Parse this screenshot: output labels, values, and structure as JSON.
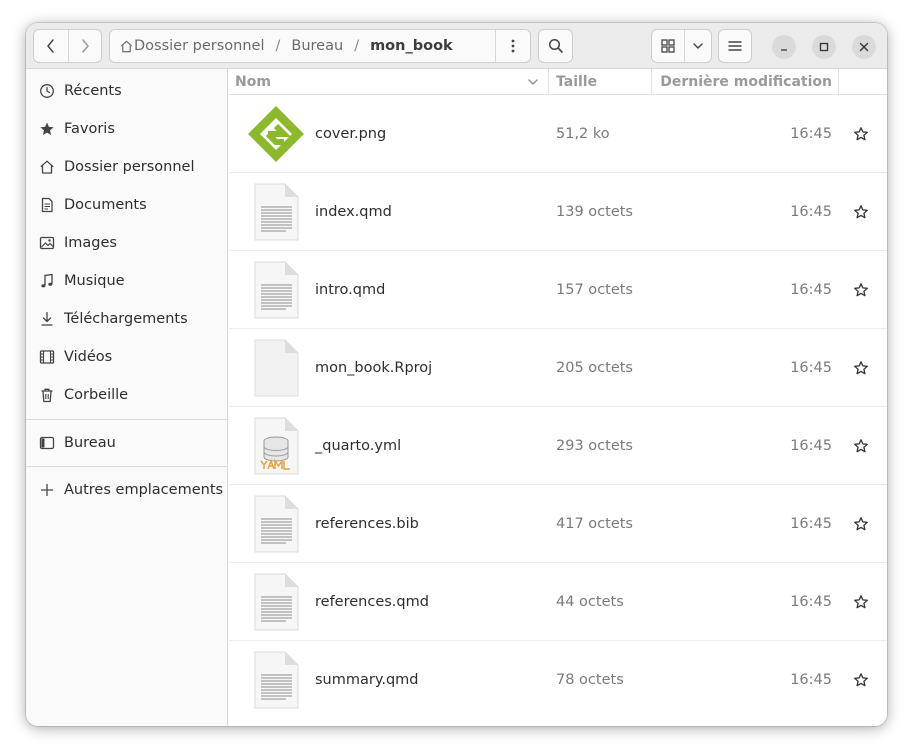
{
  "path": {
    "home": "Dossier personnel",
    "parent": "Bureau",
    "current": "mon_book",
    "separator": "/"
  },
  "sidebar": {
    "places": [
      {
        "label": "Récents",
        "icon": "clock-icon"
      },
      {
        "label": "Favoris",
        "icon": "star-icon"
      },
      {
        "label": "Dossier personnel",
        "icon": "home-icon"
      },
      {
        "label": "Documents",
        "icon": "document-icon"
      },
      {
        "label": "Images",
        "icon": "image-icon"
      },
      {
        "label": "Musique",
        "icon": "music-icon"
      },
      {
        "label": "Téléchargements",
        "icon": "download-icon"
      },
      {
        "label": "Vidéos",
        "icon": "video-icon"
      },
      {
        "label": "Corbeille",
        "icon": "trash-icon"
      }
    ],
    "bookmarks": [
      {
        "label": "Bureau",
        "icon": "desktop-icon"
      }
    ],
    "other": {
      "label": "Autres emplacements",
      "icon": "plus-icon"
    }
  },
  "columns": {
    "name": "Nom",
    "size": "Taille",
    "modified": "Dernière modification"
  },
  "files": [
    {
      "name": "cover.png",
      "size": "51,2 ko",
      "modified": "16:45",
      "type": "epub-image"
    },
    {
      "name": "index.qmd",
      "size": "139 octets",
      "modified": "16:45",
      "type": "text"
    },
    {
      "name": "intro.qmd",
      "size": "157 octets",
      "modified": "16:45",
      "type": "text"
    },
    {
      "name": "mon_book.Rproj",
      "size": "205 octets",
      "modified": "16:45",
      "type": "blank"
    },
    {
      "name": "_quarto.yml",
      "size": "293 octets",
      "modified": "16:45",
      "type": "yaml"
    },
    {
      "name": "references.bib",
      "size": "417 octets",
      "modified": "16:45",
      "type": "text"
    },
    {
      "name": "references.qmd",
      "size": "44 octets",
      "modified": "16:45",
      "type": "text"
    },
    {
      "name": "summary.qmd",
      "size": "78 octets",
      "modified": "16:45",
      "type": "text"
    }
  ],
  "colors": {
    "accent_green": "#8bb82d",
    "yaml_orange": "#e4a43a"
  }
}
